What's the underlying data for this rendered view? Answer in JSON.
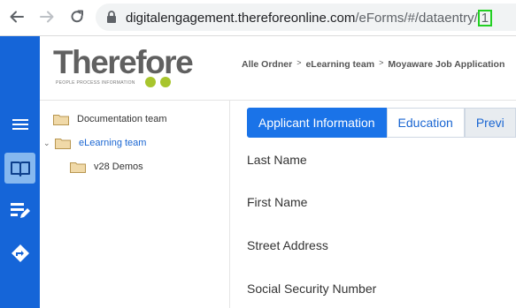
{
  "browser": {
    "url_host": "digitalengagement.thereforeonline.com",
    "url_path": "/eForms/#/dataentry/",
    "url_tail": "1"
  },
  "logo": {
    "word": "Therefore",
    "tagline": "PEOPLE  PROCESS  INFORMATION"
  },
  "breadcrumb": {
    "items": [
      "Alle Ordner",
      "eLearning team",
      "Moyaware Job Application"
    ],
    "separator": ">"
  },
  "tree": {
    "items": [
      {
        "label": "Documentation team"
      },
      {
        "label": "eLearning team"
      },
      {
        "label": "v28 Demos"
      }
    ]
  },
  "tabs": [
    {
      "label": "Applicant Information"
    },
    {
      "label": "Education"
    },
    {
      "label": "Previ"
    }
  ],
  "form": {
    "fields": [
      {
        "label": "Last Name"
      },
      {
        "label": "First Name"
      },
      {
        "label": "Street Address"
      },
      {
        "label": "Social Security Number"
      }
    ]
  },
  "colors": {
    "sidebar": "#1565d8",
    "accent": "#1a73e8",
    "logo_green": "#a8c52d",
    "highlight_box": "#22d022"
  },
  "icons": {
    "sidebar": [
      "menu-icon",
      "book-icon",
      "edit-icon",
      "route-icon"
    ],
    "browser": [
      "back-arrow-icon",
      "forward-arrow-icon",
      "reload-icon",
      "lock-icon"
    ],
    "tree": [
      "folder-icon",
      "chevron-down-icon"
    ]
  }
}
